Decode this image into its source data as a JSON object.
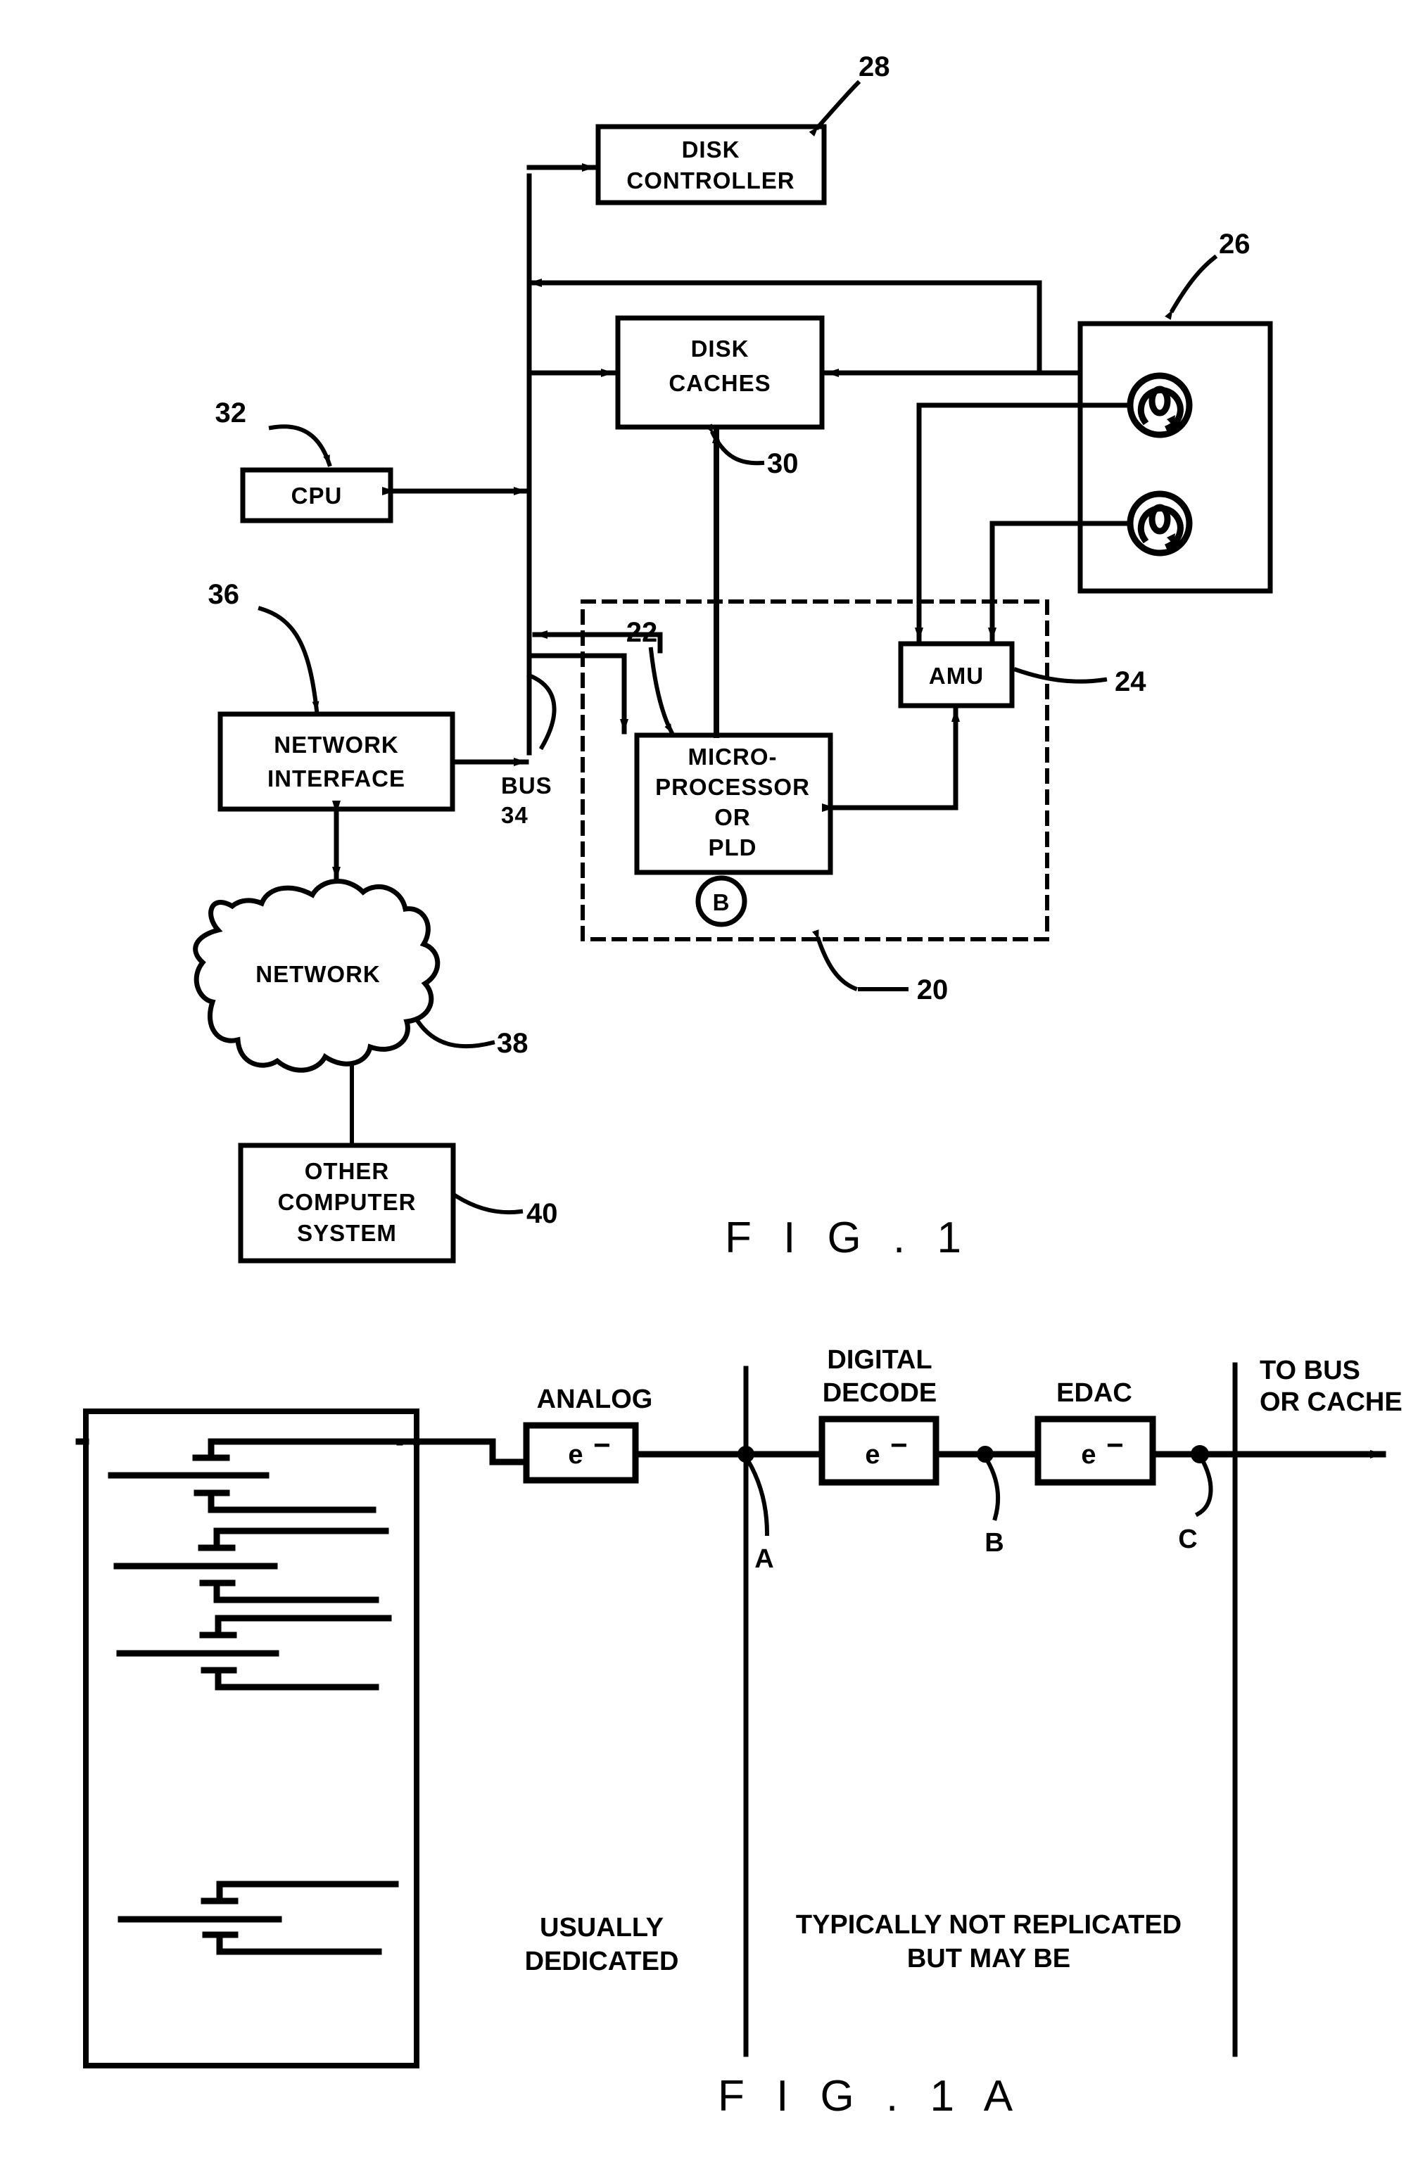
{
  "figure1": {
    "caption": "F I G . 1",
    "blocks": {
      "disk_controller": "DISK\nCONTROLLER",
      "disk_controller_line1": "DISK",
      "disk_controller_line2": "CONTROLLER",
      "disk_caches_line1": "DISK",
      "disk_caches_line2": "CACHES",
      "cpu": "CPU",
      "network_interface_line1": "NETWORK",
      "network_interface_line2": "INTERFACE",
      "network_cloud": "NETWORK",
      "other_computer_line1": "OTHER",
      "other_computer_line2": "COMPUTER",
      "other_computer_line3": "SYSTEM",
      "microprocessor_line1": "MICRO-",
      "microprocessor_line2": "PROCESSOR",
      "microprocessor_line3": "OR",
      "microprocessor_line4": "PLD",
      "amu": "AMU",
      "node_b": "B",
      "bus_line1": "BUS",
      "bus_line2": "34"
    },
    "reference_numerals": {
      "disk_controller": "28",
      "disk_array": "26",
      "amu": "24",
      "microprocessor": "22",
      "dashed_module": "20",
      "disk_caches": "30",
      "cpu": "32",
      "network_interface": "36",
      "network": "38",
      "other_computer_system": "40"
    }
  },
  "figure1a": {
    "caption": "F I G . 1 A",
    "stage_labels": {
      "analog": "ANALOG",
      "digital_decode_line1": "DIGITAL",
      "digital_decode_line2": "DECODE",
      "edac": "EDAC",
      "to_bus_line1": "TO BUS",
      "to_bus_line2": "OR CACHE"
    },
    "block_symbol": "e",
    "block_symbol_sup": "−",
    "tap_points": [
      "A",
      "B",
      "C"
    ],
    "zone_labels": {
      "left_line1": "USUALLY",
      "left_line2": "DEDICATED",
      "right_line1": "TYPICALLY NOT REPLICATED",
      "right_line2": "BUT MAY BE"
    }
  },
  "colors": {
    "ink": "#000000",
    "paper": "#ffffff"
  }
}
